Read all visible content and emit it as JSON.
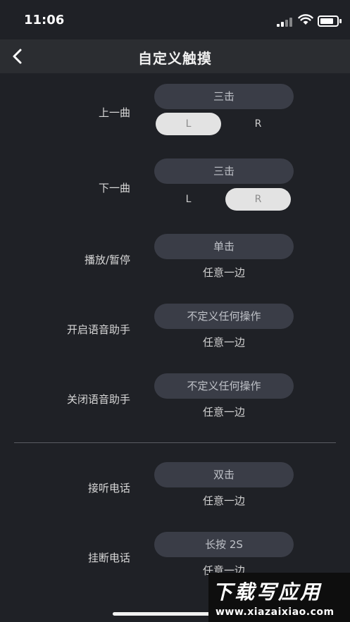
{
  "status": {
    "time": "11:06"
  },
  "nav": {
    "title": "自定义触摸",
    "back_icon": "chevron-left-icon"
  },
  "rows": [
    {
      "label": "上一曲",
      "action": "三击",
      "left": "L",
      "right": "R",
      "selected": "L"
    },
    {
      "label": "下一曲",
      "action": "三击",
      "left": "L",
      "right": "R",
      "selected": "R"
    },
    {
      "label": "播放/暂停",
      "action": "单击",
      "side": "任意一边"
    },
    {
      "label": "开启语音助手",
      "action": "不定义任何操作",
      "side": "任意一边"
    },
    {
      "label": "关闭语音助手",
      "action": "不定义任何操作",
      "side": "任意一边"
    },
    {
      "label": "接听电话",
      "action": "双击",
      "side": "任意一边"
    },
    {
      "label": "挂断电话",
      "action": "长按 2S",
      "side": "任意一边"
    }
  ],
  "watermark": {
    "title": "下载写应用",
    "url": "www.xiazaixiao.com"
  }
}
